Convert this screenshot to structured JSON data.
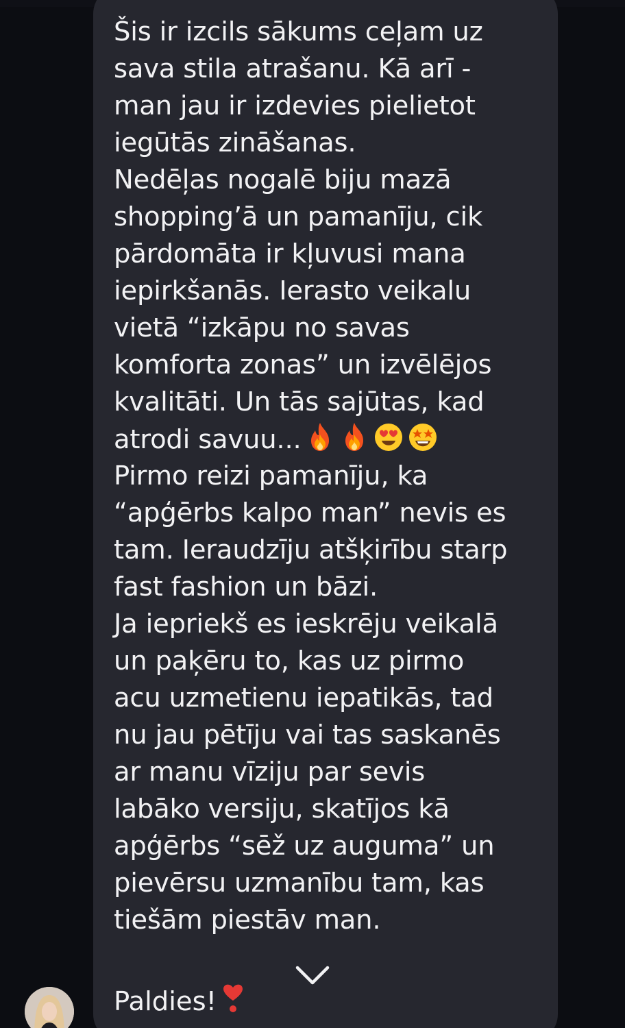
{
  "message": {
    "lines": [
      "Šis ir izcils sākums ceļam uz",
      "sava stila atrašanu. Kā arī -",
      "man jau ir izdevies pielietot",
      "iegūtās zināšanas.",
      "Nedēļas nogalē biju mazā",
      "shopping’ā  un pamanīju, cik",
      "pārdomāta ir kļuvusi mana",
      "iepirkšanās. Ierasto veikalu",
      "vietā “izkāpu no savas",
      "komforta zonas” un izvēlējos",
      "kvalitāti. Un tās sajūtas, kad",
      "atrodi savuu...",
      "Pirmo reizi pamanīju, ka",
      "“apģērbs kalpo man” nevis es",
      "tam. Ieraudzīju atšķirību starp",
      "fast fashion un bāzi.",
      "Ja iepriekš es ieskrēju veikalā",
      "un paķēru to, kas uz pirmo",
      "acu uzmetienu iepatikās, tad",
      "nu jau pētīju vai tas saskanēs",
      "ar manu vīziju par sevis",
      "labāko versiju, skatījos kā",
      "apģērbs “sēž uz auguma” un",
      "pievērsu uzmanību tam, kas",
      "tiešām piestāv man."
    ],
    "emojis": [
      "fire-emoji",
      "fire-emoji",
      "heart-eyes-emoji",
      "star-struck-emoji"
    ]
  },
  "reply": {
    "text": "Paldies!",
    "emoji": "heart-exclamation-emoji"
  },
  "icons": {
    "scroll": "chevron-down-icon",
    "avatar": "avatar"
  },
  "colors": {
    "background": "#0c0d12",
    "bubble": "#26272f",
    "text": "#f2f2f4"
  }
}
